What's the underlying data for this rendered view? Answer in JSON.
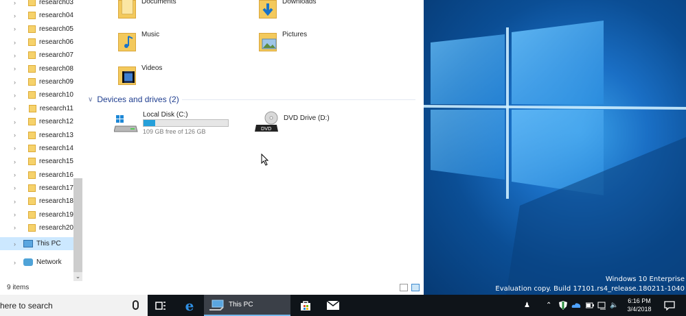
{
  "explorer": {
    "nav_pane": {
      "folders": [
        "research03",
        "research04",
        "research05",
        "research06",
        "research07",
        "research08",
        "research09",
        "research10",
        "research11",
        "research12",
        "research13",
        "research14",
        "research15",
        "research16",
        "research17",
        "research18",
        "research19",
        "research20"
      ],
      "this_pc": "This PC",
      "network": "Network"
    },
    "folders": {
      "documents": "Documents",
      "downloads": "Downloads",
      "music": "Music",
      "pictures": "Pictures",
      "videos": "Videos"
    },
    "devices_header": "Devices and drives (2)",
    "drives": {
      "c_name": "Local Disk (C:)",
      "c_free": "109 GB free of 126 GB",
      "c_used_fraction": 0.135,
      "d_name": "DVD Drive (D:)",
      "d_label": "DVD"
    },
    "status": {
      "item_count": "9 items"
    }
  },
  "desktop": {
    "watermark_line1": "Windows 10 Enterprise",
    "watermark_line2": "Evaluation copy. Build 17101.rs4_release.180211-1040"
  },
  "taskbar": {
    "search_text": "here to search",
    "this_pc_label": "This PC",
    "time": "6:16 PM",
    "date": "3/4/2018"
  },
  "colors": {
    "accent": "#26a0da",
    "taskbar": "#0f1419",
    "selection": "#cce8ff"
  }
}
